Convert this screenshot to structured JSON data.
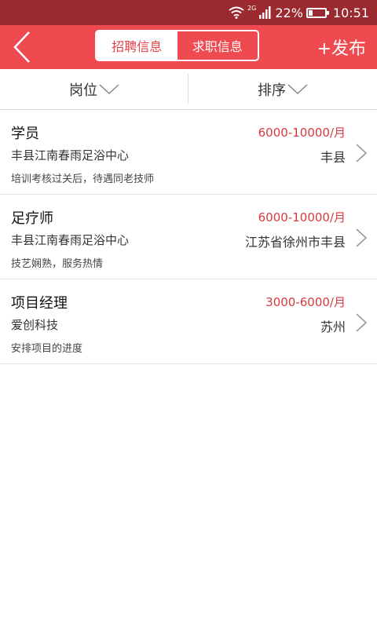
{
  "status_bar": {
    "network": "2G",
    "battery": "22%",
    "battery_level": 0.22,
    "time": "10:51"
  },
  "header": {
    "tabs": [
      {
        "label": "招聘信息",
        "active": true
      },
      {
        "label": "求职信息",
        "active": false
      }
    ],
    "publish_label": "+发布"
  },
  "filters": [
    {
      "label": "岗位"
    },
    {
      "label": "排序"
    }
  ],
  "jobs": [
    {
      "title": "学员",
      "salary": "6000-10000/月",
      "company": "丰县江南春雨足浴中心",
      "location": "丰县",
      "description": "培训考核过关后，待遇同老技师"
    },
    {
      "title": "足疗师",
      "salary": "6000-10000/月",
      "company": "丰县江南春雨足浴中心",
      "location": "江苏省徐州市丰县",
      "description": "技艺娴熟，服务热情"
    },
    {
      "title": "项目经理",
      "salary": "3000-6000/月",
      "company": "爱创科技",
      "location": "苏州",
      "description": "安排项目的进度"
    }
  ],
  "colors": {
    "status_bar": "#9a2a30",
    "header": "#ee4a4f",
    "salary": "#d73a3f"
  }
}
